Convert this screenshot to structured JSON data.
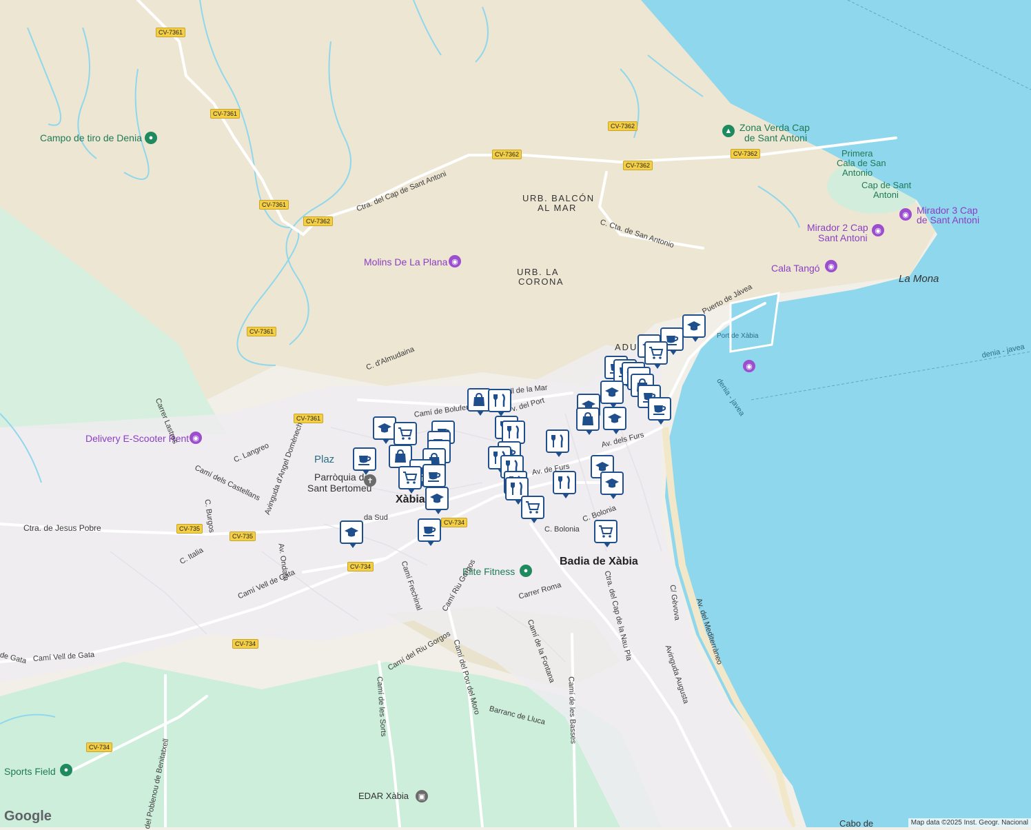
{
  "places": {
    "campo_tiro": "Campo de tiro de Denia",
    "zona_verda_1": "Zona Verda Cap",
    "zona_verda_2": "de Sant Antoni",
    "primera_cala_1": "Primera",
    "primera_cala_2": "Cala de San",
    "primera_cala_3": "Antonio",
    "cap_sant_antoni_1": "Cap de Sant",
    "cap_sant_antoni_2": "Antoni",
    "mirador3_1": "Mirador 3 Cap",
    "mirador3_2": "de Sant Antoni",
    "mirador2_1": "Mirador 2 Cap",
    "mirador2_2": "Sant Antoni",
    "cala_tango": "Cala Tangó",
    "la_mona": "La Mona",
    "urb_balcon_1": "URB. BALCÓN",
    "urb_balcon_2": "AL MAR",
    "urb_corona_1": "URB. LA",
    "urb_corona_2": "CORONA",
    "molins": "Molins De La Plana",
    "port_xabia": "Port de Xàbia",
    "delivery": "Delivery E-Scooter Rent",
    "parroquia_1": "Parròquia de",
    "parroquia_2": "Sant Bertomeu",
    "xabia": "Xàbia",
    "badia": "Badia de Xàbia",
    "elite_fitness": "Elite Fitness",
    "sports_field": "Sports Field",
    "edar": "EDAR Xàbia",
    "adu": "ADU",
    "plaza": "Plaz",
    "cabo": "Cabo de"
  },
  "streets": {
    "ctra_cap": "Ctra. del Cap de Sant Antoni",
    "c_cta_san_antonio": "C. Cta. de San Antonio",
    "puerto_javea": "Puerto de Jávea",
    "c_almudaina": "C. d'Almudaina",
    "cami_bolufer": "Camí de Bolufer",
    "ll_mar": "ll de la Mar",
    "av_port": "v. del Port",
    "av_furs": "Av. dels Furs",
    "av_furs2": "Av. de   Furs",
    "carrer_lastres": "Carrer Lastres",
    "c_langreo": "C. Langreo",
    "angel_domenech": "Avinguda d'Angel Domènech",
    "cami_castellans": "Camí dels Castellans",
    "c_burgos": "C. Burgos",
    "ctra_jesus_pobre": "Ctra. de Jesus Pobre",
    "c_italia": "C. Italia",
    "av_ondara": "Av. Ondara",
    "cami_vell_gata": "Camí Vell de Gata",
    "cami_vell_gata2": "Camí Vell de Gata",
    "de_gata": "de Gata",
    "ronda_sud": "da Sud",
    "c_bolonia": "C. Bolonia",
    "c_bolonia2": "C. Bolonia",
    "cami_frechinal": "Camí Frechinal",
    "cami_riu_gorgos": "Camí Riu Gorgos",
    "carrer_roma": "Carrer Roma",
    "cami_fontana": "Camí de la Fontana",
    "ctra_cap_nau": "Ctra. del Cap de la Nau Pla",
    "c_gevova": "C/ Gèvova",
    "av_mediterraneo": "Av. del Mediterràneo",
    "av_augusta": "Avinguda Augusta",
    "cami_riu_gorgos2": "Camí del Riu Gorgos",
    "cami_pou_moro": "Camí del Pou del Moro",
    "cami_sorts": "Camí de les Sorts",
    "barranc_llucs": "Barranc de Lluca",
    "cami_basses": "Camí de les Basses",
    "poblenou": "del Poblenou de Benitatxell",
    "denia_javea": "denia - javea",
    "denia_javea2": "denia - javea"
  },
  "road_shields": {
    "cv7361_a": "CV-7361",
    "cv7361_b": "CV-7361",
    "cv7361_c": "CV-7361",
    "cv7361_d": "CV-7361",
    "cv7361_e": "CV-7361",
    "cv7362_a": "CV-7362",
    "cv7362_b": "CV-7362",
    "cv7362_c": "CV-7362",
    "cv7362_d": "CV-7362",
    "cv7362_e": "CV-7362",
    "cv735_a": "CV-735",
    "cv735_b": "CV-735",
    "cv734_a": "CV-734",
    "cv734_b": "CV-734",
    "cv734_c": "CV-734",
    "cv734_d": "CV-734"
  },
  "attribution": "Map data ©2025 Inst. Geogr. Nacional",
  "google_logo": "Google",
  "colors": {
    "land": "#f1efe8",
    "hills": "#ece6d6",
    "green": "#c6ecd5",
    "water": "#8fd7ec",
    "road": "#ffffff",
    "pin_border": "#1e4f8c"
  }
}
